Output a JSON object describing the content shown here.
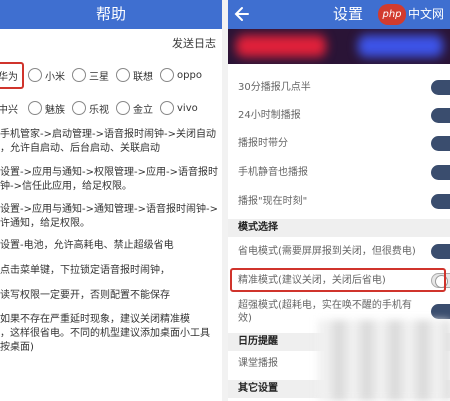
{
  "left": {
    "title": "帮助",
    "send_log": "发送日志",
    "brands_row1": [
      {
        "label": "华为",
        "selected": true
      },
      {
        "label": "小米",
        "selected": false
      },
      {
        "label": "三星",
        "selected": false
      },
      {
        "label": "联想",
        "selected": false
      },
      {
        "label": "oppo",
        "selected": false
      }
    ],
    "brands_row2": [
      {
        "label": "中兴",
        "selected": false
      },
      {
        "label": "魅族",
        "selected": false
      },
      {
        "label": "乐视",
        "selected": false
      },
      {
        "label": "金立",
        "selected": false
      },
      {
        "label": "vivo",
        "selected": false
      }
    ],
    "paragraphs": [
      "手机管家->启动管理->语音报时闹钟->关闭自动\n，允许自启动、后台启动、关联启动",
      "设置->应用与通知->权限管理->应用->语音报时\n钟->信任此应用，给足权限。",
      "设置->应用与通知->通知管理->语音报时闹钟->\n许通知，给足权限。",
      "设置-电池，允许高耗电、禁止超级省电",
      "点击菜单键，下拉锁定语音报时闹钟，",
      "读写权限一定要开，否则配置不能保存",
      "如果不存在严重延时现象，建议关闭精准模\n，这样很省电。不同的机型建议添加桌面小工具\n按桌面)"
    ]
  },
  "right": {
    "title": "设置",
    "watermark_logo": "php",
    "watermark_text": "中文网",
    "rows_top": [
      {
        "label": "30分播报几点半",
        "on": true
      },
      {
        "label": "24小时制播报",
        "on": true
      },
      {
        "label": "播报时带分",
        "on": true
      },
      {
        "label": "手机静音也播报",
        "on": true
      },
      {
        "label": "播报\"现在时刻\"",
        "on": true
      }
    ],
    "section_mode": "模式选择",
    "rows_mode": [
      {
        "label": "省电模式(需要屏屏报到关闭，但很费电)",
        "on": true
      },
      {
        "label": "精准模式(建议关闭，关闭后省电)",
        "on": false
      },
      {
        "label": "超强模式(超耗电，实在唤不醒的手机有效)",
        "on": true
      }
    ],
    "section_calendar": "日历提醒",
    "row_lunar": "课堂播报",
    "section_other": "其它设置"
  },
  "colors": {
    "header": "#3f6fd0",
    "highlight": "#d0342c",
    "toggle_on": "#3a4d6e"
  }
}
